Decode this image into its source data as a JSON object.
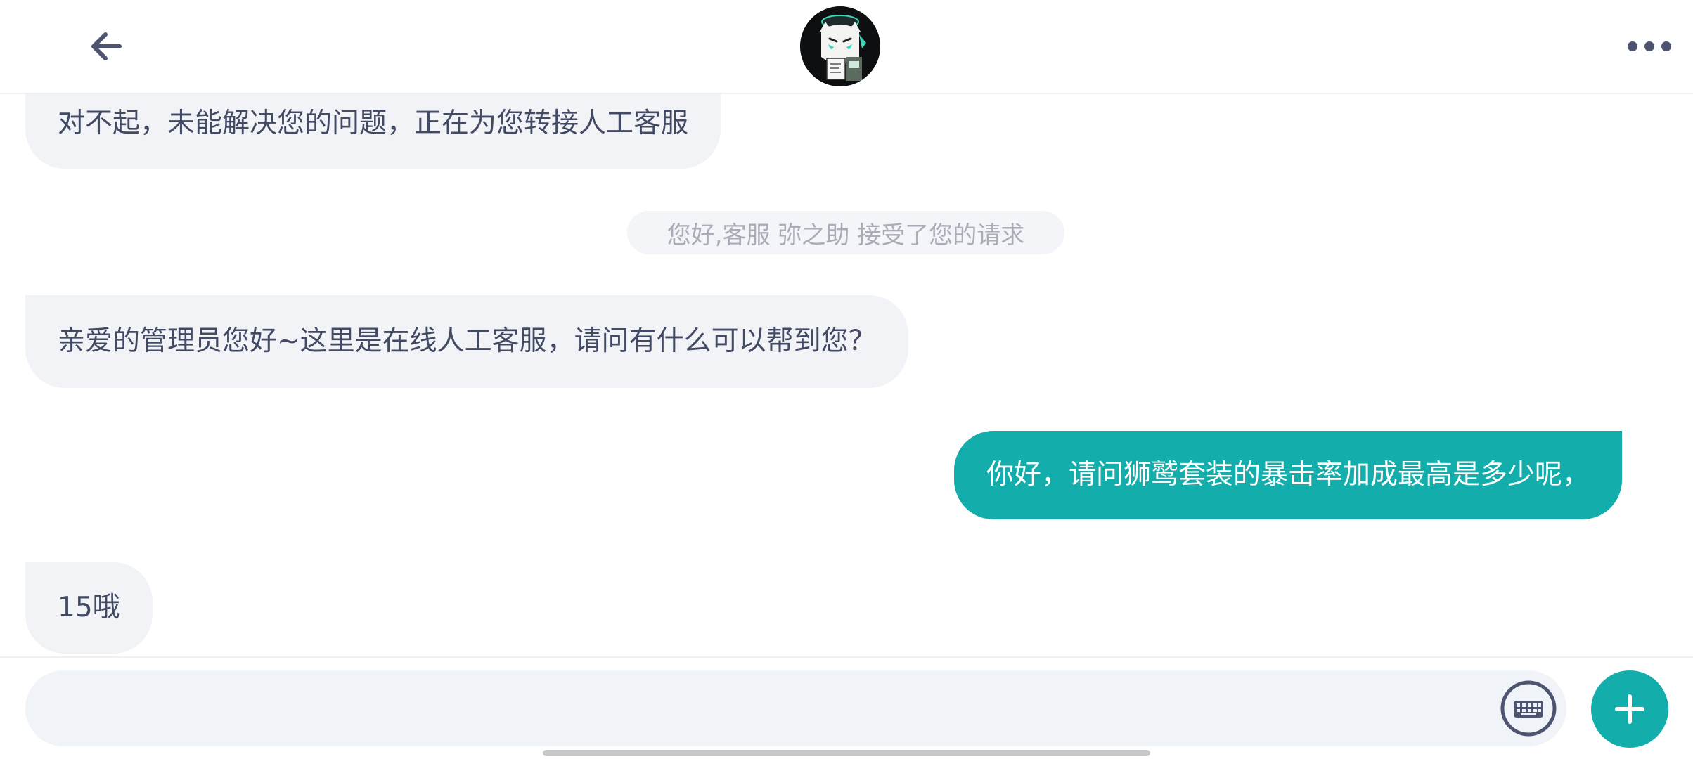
{
  "header": {
    "back_icon": "arrow-left-icon",
    "avatar_icon": "agent-avatar-icon",
    "more_icon": "more-horizontal-icon"
  },
  "messages": [
    {
      "side": "left",
      "text": "对不起，未能解决您的问题，正在为您转接人工客服"
    },
    {
      "side": "system",
      "text": "您好,客服 弥之助 接受了您的请求"
    },
    {
      "side": "left",
      "text": "亲爱的管理员您好~这里是在线人工客服，请问有什么可以帮到您？"
    },
    {
      "side": "right",
      "text": "你好，请问狮鹫套装的暴击率加成最高是多少呢，"
    },
    {
      "side": "left",
      "text": "15哦"
    }
  ],
  "composer": {
    "value": "",
    "placeholder": "",
    "keyboard_icon": "keyboard-icon",
    "plus_icon": "plus-icon"
  },
  "colors": {
    "accent": "#13aeab",
    "bubble_left": "#f1f3f7",
    "text": "#434a64",
    "notice_text": "#a9adb8"
  }
}
